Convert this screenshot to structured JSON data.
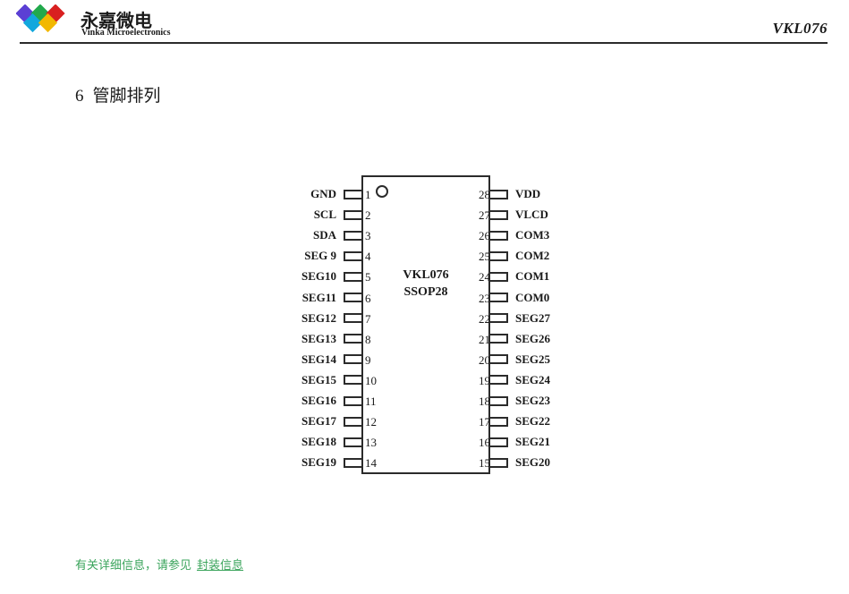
{
  "header": {
    "brand_cn": "永嘉微电",
    "brand_en": "Vinka Microelectronics",
    "part_number": "VKL076",
    "logo_icon": "diamond-cluster-logo",
    "logo_colors": [
      "#5b3fd4",
      "#22a94c",
      "#d92020",
      "#12a7dd",
      "#f2b800"
    ]
  },
  "section": {
    "number": "6",
    "title": "管脚排列"
  },
  "chip": {
    "part_name": "VKL076",
    "package": "SSOP28",
    "pin1_marker": "pin1-indicator-circle",
    "left_pins": [
      {
        "number": "1",
        "label": "GND"
      },
      {
        "number": "2",
        "label": "SCL"
      },
      {
        "number": "3",
        "label": "SDA"
      },
      {
        "number": "4",
        "label": "SEG 9"
      },
      {
        "number": "5",
        "label": "SEG10"
      },
      {
        "number": "6",
        "label": "SEG11"
      },
      {
        "number": "7",
        "label": "SEG12"
      },
      {
        "number": "8",
        "label": "SEG13"
      },
      {
        "number": "9",
        "label": "SEG14"
      },
      {
        "number": "10",
        "label": "SEG15"
      },
      {
        "number": "11",
        "label": "SEG16"
      },
      {
        "number": "12",
        "label": "SEG17"
      },
      {
        "number": "13",
        "label": "SEG18"
      },
      {
        "number": "14",
        "label": "SEG19"
      }
    ],
    "right_pins": [
      {
        "number": "28",
        "label": "VDD"
      },
      {
        "number": "27",
        "label": "VLCD"
      },
      {
        "number": "26",
        "label": "COM3"
      },
      {
        "number": "25",
        "label": "COM2"
      },
      {
        "number": "24",
        "label": "COM1"
      },
      {
        "number": "23",
        "label": "COM0"
      },
      {
        "number": "22",
        "label": "SEG27"
      },
      {
        "number": "21",
        "label": "SEG26"
      },
      {
        "number": "20",
        "label": "SEG25"
      },
      {
        "number": "19",
        "label": "SEG24"
      },
      {
        "number": "18",
        "label": "SEG23"
      },
      {
        "number": "17",
        "label": "SEG22"
      },
      {
        "number": "16",
        "label": "SEG21"
      },
      {
        "number": "15",
        "label": "SEG20"
      }
    ]
  },
  "footer": {
    "note_text": "有关详细信息，请参见",
    "link_text": "封装信息",
    "color": "#3aa45b"
  }
}
